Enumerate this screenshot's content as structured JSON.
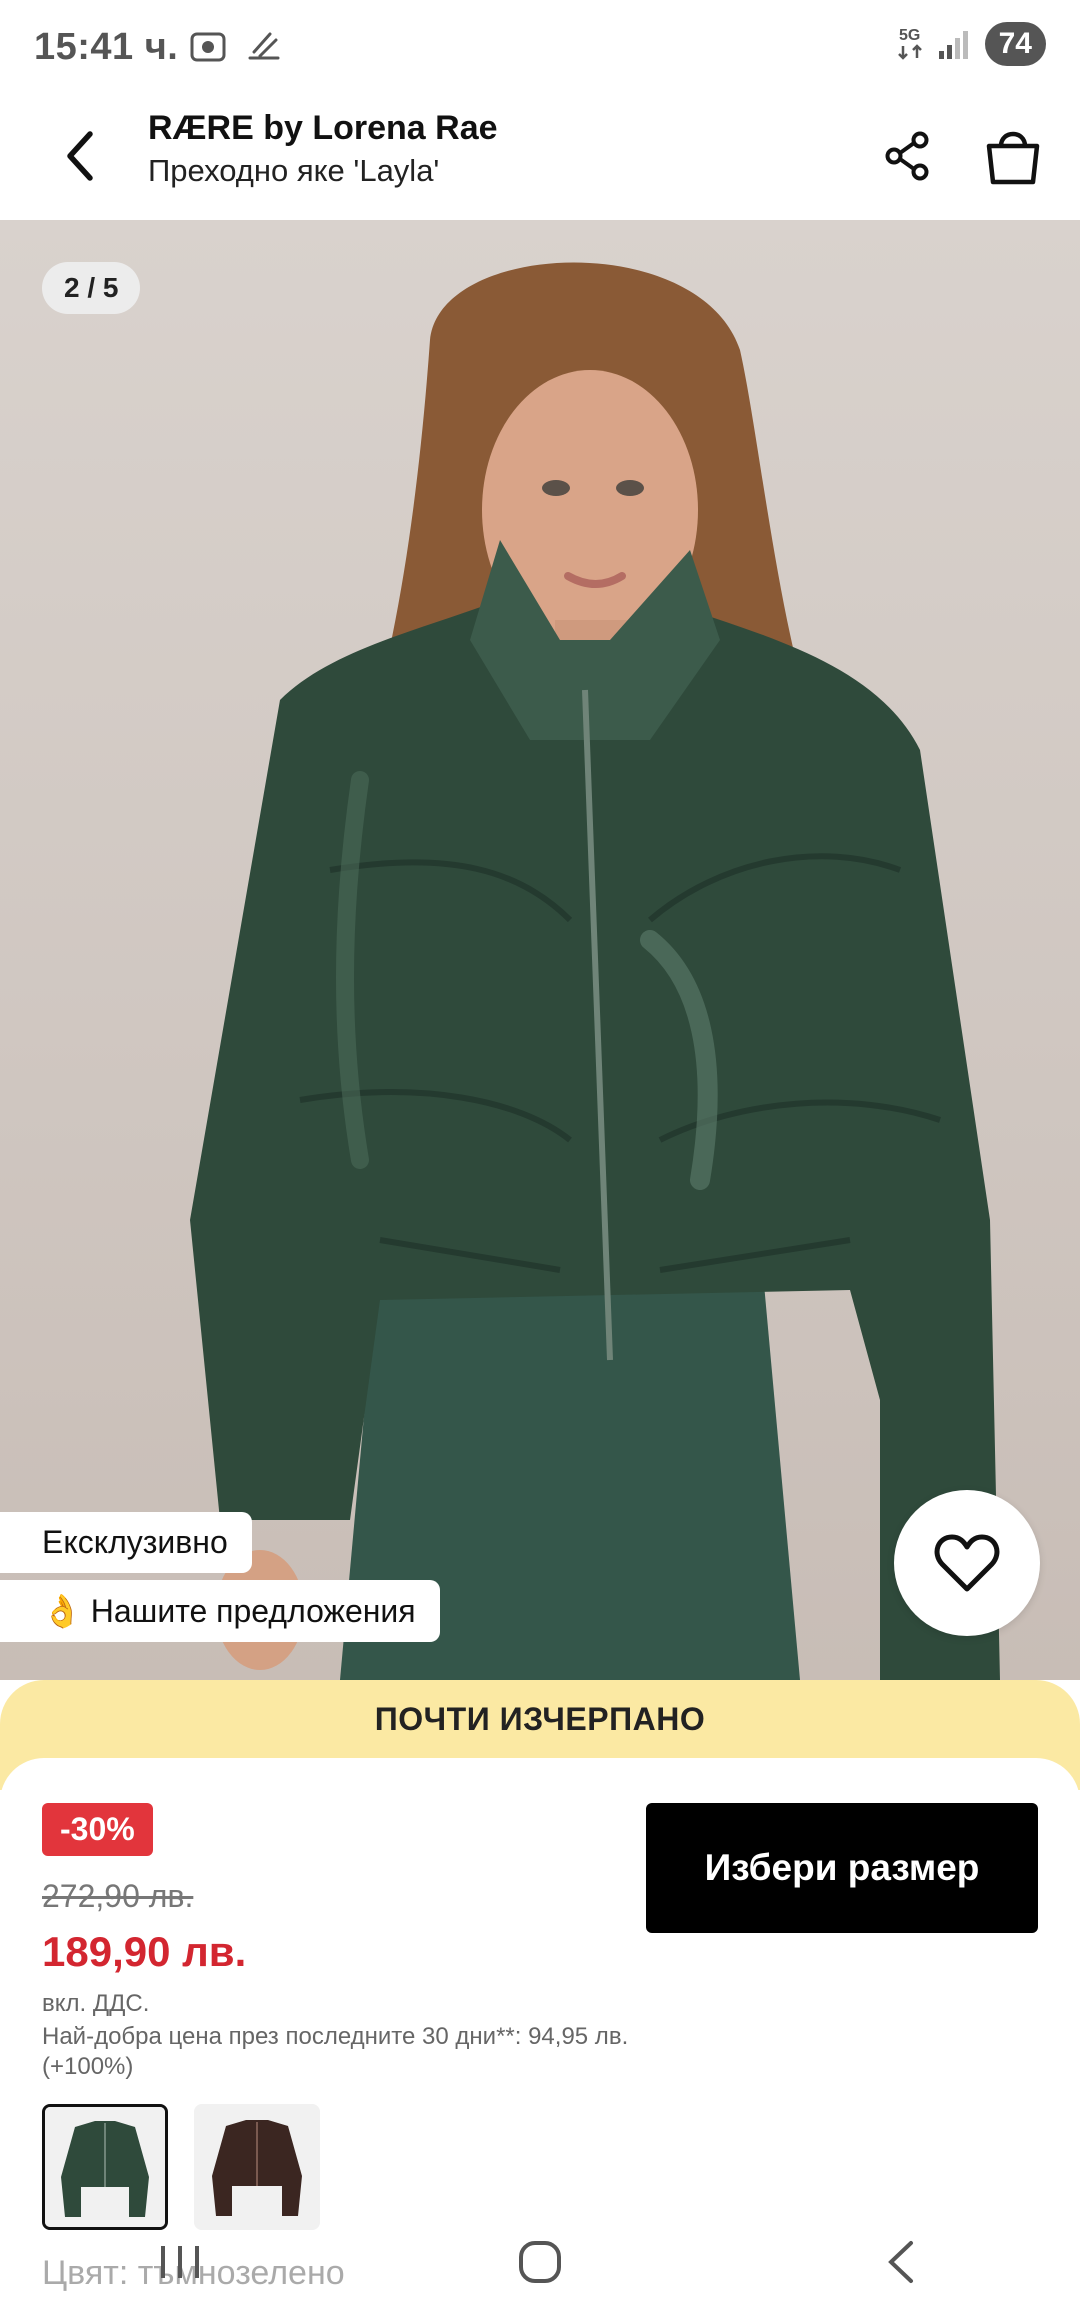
{
  "status_bar": {
    "time": "15:41 ч.",
    "network": "5G",
    "battery": "74"
  },
  "header": {
    "brand": "RÆRE by Lorena Rae",
    "product_name": "Преходно яке 'Layla'"
  },
  "gallery": {
    "counter": "2 / 5"
  },
  "badges": {
    "exclusive": "Ексклузивно",
    "offers": "👌 Нашите предложения"
  },
  "stock": {
    "label": "ПОЧТИ ИЗЧЕРПАНО"
  },
  "pricing": {
    "discount": "-30%",
    "old_price": "272,90 лв.",
    "new_price": "189,90 лв.",
    "vat": "вкл. ДДС.",
    "best_price": "Най-добра цена през последните 30 дни**: 94,95 лв. (+100%)"
  },
  "actions": {
    "choose_size": "Избери размер"
  },
  "color": {
    "label": "Цвят: тъмнозелено",
    "swatches": [
      "тъмнозелено",
      "кафяво"
    ]
  },
  "colors": {
    "discount_red": "#e2353c",
    "price_red": "#d32630",
    "banner_yellow": "#fbe9a3",
    "jacket_green": "#2f4a3b"
  }
}
